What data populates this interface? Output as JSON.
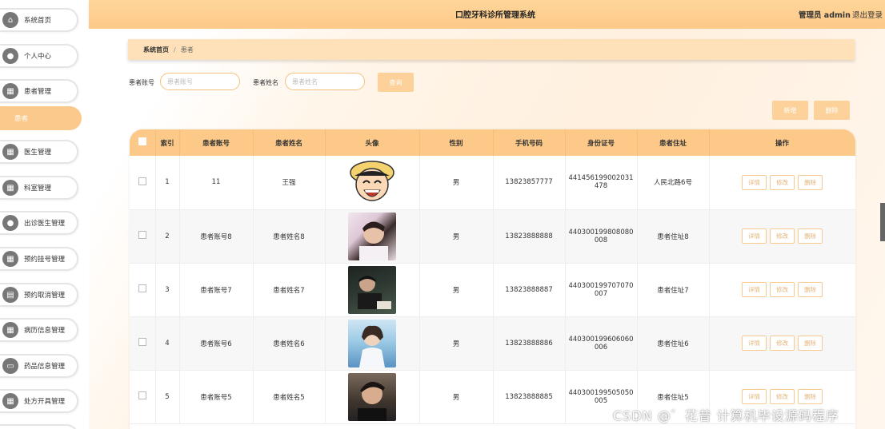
{
  "app": {
    "title": "口腔牙科诊所管理系统",
    "user": "管理员 admin",
    "logout": "退出登录"
  },
  "sidebar": {
    "items": [
      {
        "label": "系统首页",
        "icon": "home-icon"
      },
      {
        "label": "个人中心",
        "icon": "user-icon"
      },
      {
        "label": "患者管理",
        "icon": "grid-icon"
      },
      {
        "label": "医生管理",
        "icon": "grid-icon"
      },
      {
        "label": "科室管理",
        "icon": "grid-icon"
      },
      {
        "label": "出诊医生管理",
        "icon": "user-icon"
      },
      {
        "label": "预约挂号管理",
        "icon": "grid-icon"
      },
      {
        "label": "预约取消管理",
        "icon": "file-icon"
      },
      {
        "label": "病历信息管理",
        "icon": "grid-icon"
      },
      {
        "label": "药品信息管理",
        "icon": "chat-icon"
      },
      {
        "label": "处方开具管理",
        "icon": "grid-icon"
      }
    ],
    "active_sub": "患者"
  },
  "breadcrumb": {
    "home": "系统首页",
    "sep": "/",
    "current": "患者"
  },
  "search": {
    "account_label": "患者账号",
    "account_placeholder": "患者账号",
    "name_label": "患者姓名",
    "name_placeholder": "患者姓名",
    "query_button": "查询"
  },
  "toolbar": {
    "add_label": "新增",
    "delete_label": "删除"
  },
  "table": {
    "columns": [
      "",
      "索引",
      "患者账号",
      "患者姓名",
      "头像",
      "性别",
      "手机号码",
      "身份证号",
      "患者住址",
      "操作"
    ],
    "actions": {
      "detail": "详情",
      "edit": "修改",
      "delete": "删除"
    },
    "rows": [
      {
        "index": "1",
        "account": "11",
        "name": "王强",
        "avatar": "cartoon-avatar",
        "gender": "男",
        "phone": "13823857777",
        "id_line1": "441456199002031",
        "id_line2": "478",
        "address": "人民北路6号"
      },
      {
        "index": "2",
        "account": "患者账号8",
        "name": "患者姓名8",
        "avatar": "photo-avatar",
        "gender": "男",
        "phone": "13823888888",
        "id_line1": "440300199808080",
        "id_line2": "008",
        "address": "患者住址8"
      },
      {
        "index": "3",
        "account": "患者账号7",
        "name": "患者姓名7",
        "avatar": "photo-avatar",
        "gender": "男",
        "phone": "13823888887",
        "id_line1": "440300199707070",
        "id_line2": "007",
        "address": "患者住址7"
      },
      {
        "index": "4",
        "account": "患者账号6",
        "name": "患者姓名6",
        "avatar": "photo-avatar",
        "gender": "男",
        "phone": "13823888886",
        "id_line1": "440300199606060",
        "id_line2": "006",
        "address": "患者住址6"
      },
      {
        "index": "5",
        "account": "患者账号5",
        "name": "患者姓名5",
        "avatar": "photo-avatar",
        "gender": "男",
        "phone": "13823888885",
        "id_line1": "440300199505050",
        "id_line2": "005",
        "address": "患者住址5"
      }
    ]
  },
  "watermark": "CSDN @゛花昔 计算机毕设源码程序",
  "colors": {
    "accent": "#fdc988",
    "active": "#fbc98b",
    "button": "#fcd19a"
  }
}
